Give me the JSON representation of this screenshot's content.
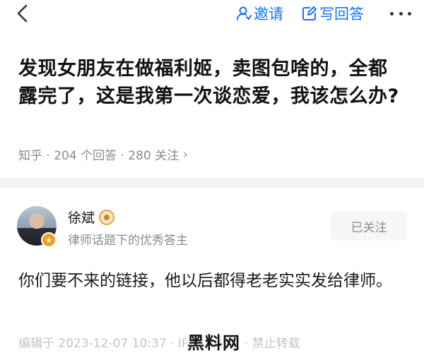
{
  "topbar": {
    "invite_label": "邀请",
    "write_label": "写回答"
  },
  "question": {
    "title": "发现女朋友在做福利姬，卖图包啥的，全都露完了，这是我第一次谈恋爱，我该怎么办?",
    "meta": "知乎 · 204 个回答 · 280 关注",
    "meta_chevron": "›"
  },
  "answer": {
    "author_name": "徐斌",
    "author_desc": "律师话题下的优秀答主",
    "follow_label": "已关注",
    "content": "你们要不来的链接，他以后都得老老实实发给律师。",
    "meta": "编辑于 2023-12-07 10:37 · IP 属地北京 · 禁止转载"
  },
  "watermark": "黑料网",
  "colors": {
    "accent": "#1772f6",
    "muted": "#8a8a8a"
  }
}
